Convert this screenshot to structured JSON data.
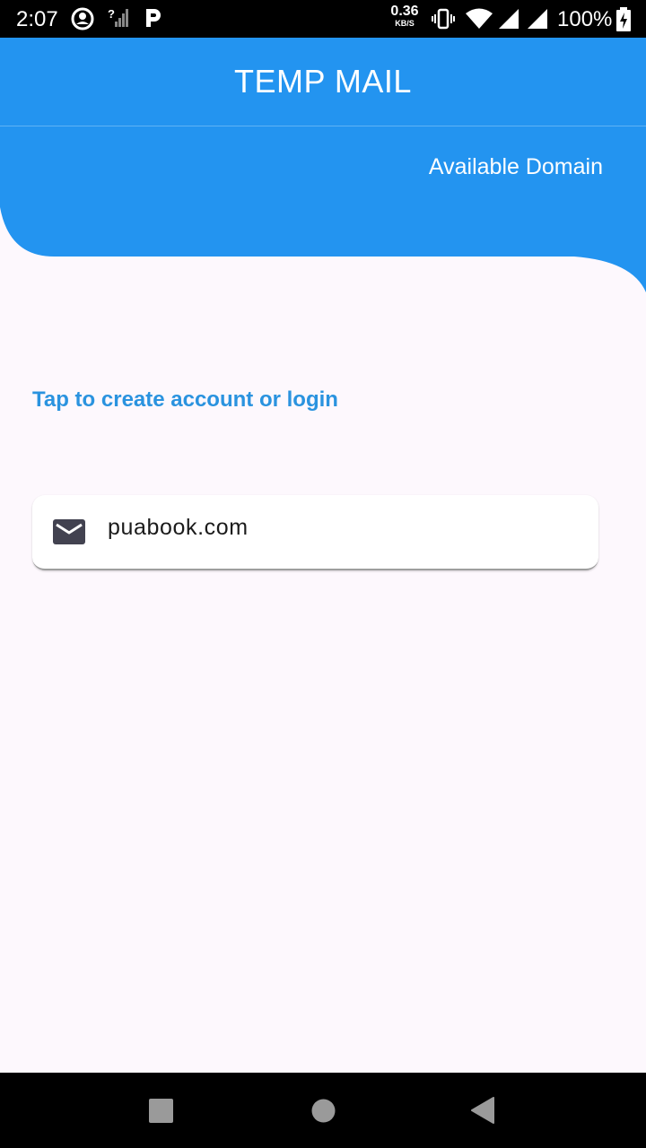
{
  "status_bar": {
    "time": "2:07",
    "net_speed_value": "0.36",
    "net_speed_unit": "KB/S",
    "battery_percent": "100%"
  },
  "app_bar": {
    "title": "TEMP MAIL"
  },
  "header": {
    "available_domain_label": "Available Domain"
  },
  "main": {
    "login_prompt": "Tap to create account or login",
    "domain_card": {
      "icon": "mail-icon",
      "domain": "puabook.com"
    }
  },
  "nav_bar": {
    "icons": [
      "recents-square-icon",
      "home-circle-icon",
      "back-triangle-icon"
    ]
  },
  "colors": {
    "primary": "#2394f0",
    "link": "#2a93df",
    "background": "#fdf8fd",
    "icon_dark": "#424250"
  }
}
